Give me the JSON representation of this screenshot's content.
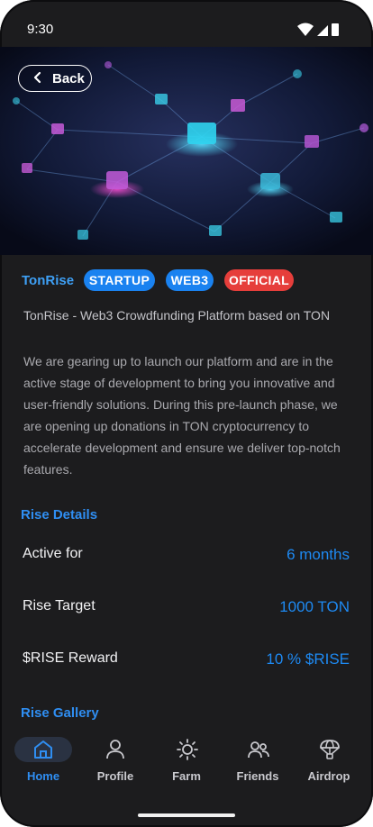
{
  "status_bar": {
    "time": "9:30"
  },
  "hero": {
    "back_label": "Back"
  },
  "project": {
    "name": "TonRise",
    "tags": [
      "STARTUP",
      "WEB3",
      "OFFICIAL"
    ],
    "subtitle": "TonRise - Web3 Crowdfunding Platform based on TON",
    "description": "We are gearing up to launch our platform and are in the active stage of development to bring you innovative and user-friendly solutions. During this pre-launch phase, we are opening up donations in TON cryptocurrency to accelerate development and ensure we deliver top-notch features."
  },
  "rise_details": {
    "title": "Rise Details",
    "rows": [
      {
        "label": "Active for",
        "value": "6 months"
      },
      {
        "label": "Rise Target",
        "value": "1000 TON"
      },
      {
        "label": "$RISE Reward",
        "value": "10 % $RISE"
      }
    ]
  },
  "rise_gallery": {
    "title": "Rise Gallery"
  },
  "tabbar": {
    "tabs": [
      {
        "label": "Home",
        "icon": "home-icon",
        "active": true
      },
      {
        "label": "Profile",
        "icon": "user-icon",
        "active": false
      },
      {
        "label": "Farm",
        "icon": "sun-icon",
        "active": false
      },
      {
        "label": "Friends",
        "icon": "users-icon",
        "active": false
      },
      {
        "label": "Airdrop",
        "icon": "parachute-icon",
        "active": false
      }
    ]
  },
  "colors": {
    "background": "#1c1c1e",
    "accent": "#2f8ef2",
    "tag_blue": "#1a82f0",
    "tag_red": "#e63e3b"
  }
}
